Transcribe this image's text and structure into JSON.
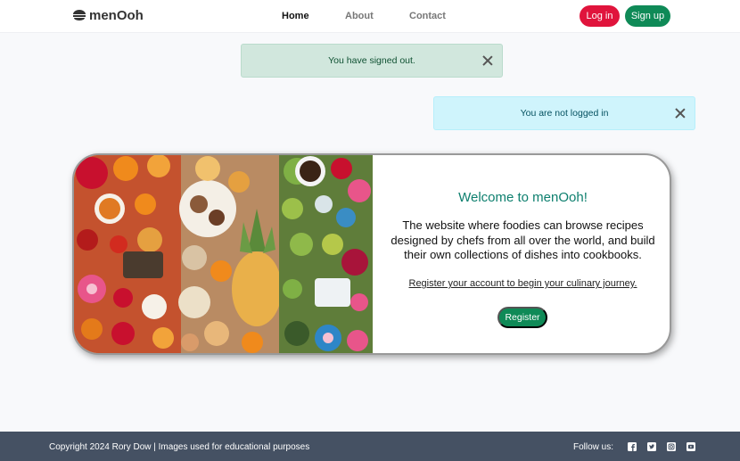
{
  "brand": {
    "name": "menOoh",
    "icon": "pot-icon"
  },
  "nav": {
    "home": "Home",
    "about": "About",
    "contact": "Contact"
  },
  "auth": {
    "login": "Log in",
    "signup": "Sign up"
  },
  "alerts": {
    "signed_out": "You have signed out.",
    "not_logged_in": "You are not logged in"
  },
  "hero": {
    "title": "Welcome to menOoh!",
    "text": "The website where foodies can browse recipes designed by chefs from all over the world, and build their own collections of dishes into cookbooks.",
    "link": "Register your account to begin your culinary journey.",
    "register": "Register"
  },
  "footer": {
    "copyright": "Copyright 2024 Rory Dow | Images used for educational purposes",
    "follow": "Follow us:",
    "socials": [
      "facebook-icon",
      "twitter-icon",
      "instagram-icon",
      "youtube-icon"
    ]
  },
  "colors": {
    "brand_green": "#0f8a57",
    "login_red": "#e0143c",
    "title_teal": "#0d7f6e",
    "footer_bg": "#455163"
  }
}
